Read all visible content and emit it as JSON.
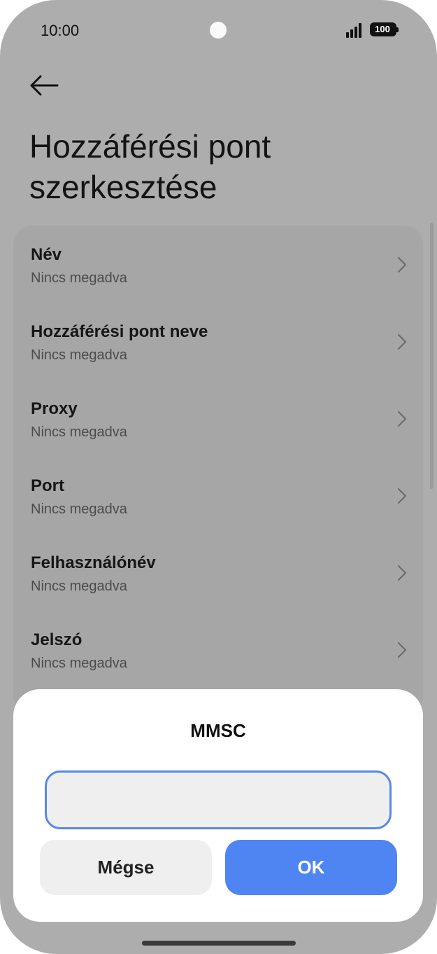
{
  "status_bar": {
    "time": "10:00",
    "battery": "100"
  },
  "header": {
    "title": "Hozzáférési pont szerkesztése"
  },
  "settings": [
    {
      "label": "Név",
      "value": "Nincs megadva"
    },
    {
      "label": "Hozzáférési pont neve",
      "value": "Nincs megadva"
    },
    {
      "label": "Proxy",
      "value": "Nincs megadva"
    },
    {
      "label": "Port",
      "value": "Nincs megadva"
    },
    {
      "label": "Felhasználónév",
      "value": "Nincs megadva"
    },
    {
      "label": "Jelszó",
      "value": "Nincs megadva"
    }
  ],
  "dialog": {
    "title": "MMSC",
    "input_value": "",
    "cancel_label": "Mégse",
    "ok_label": "OK"
  },
  "colors": {
    "accent": "#4f85f2",
    "field_border": "#5a88e3",
    "scrim": "#adadad"
  }
}
